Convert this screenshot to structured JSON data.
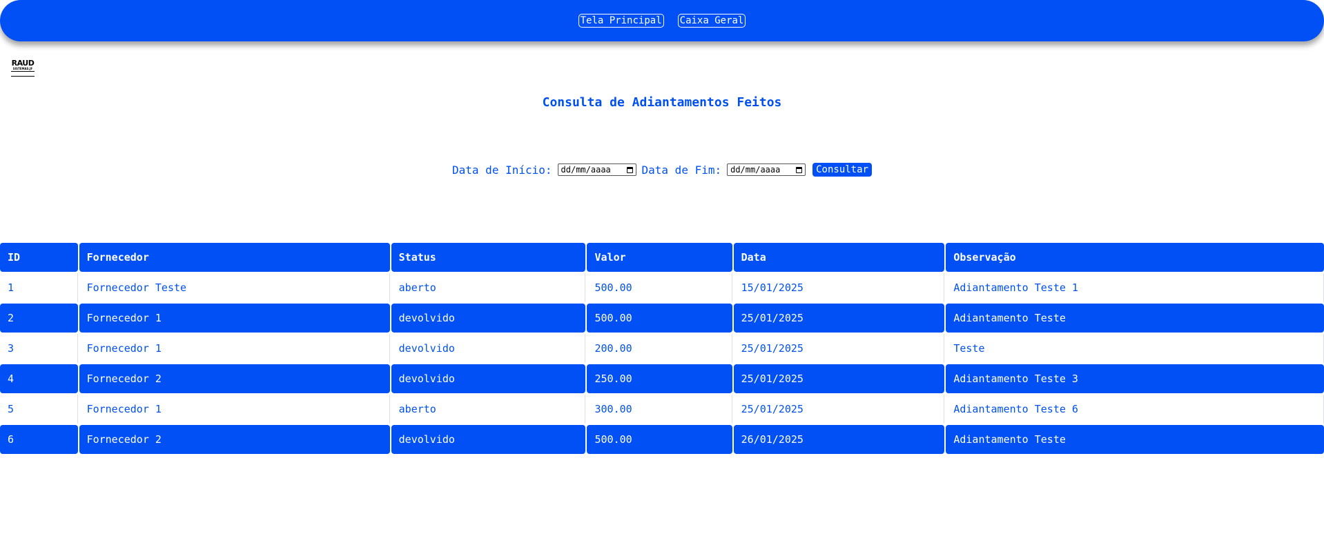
{
  "nav": {
    "buttons": [
      {
        "label": "Tela Principal"
      },
      {
        "label": "Caixa Geral"
      }
    ]
  },
  "logo": {
    "text": "RAUD",
    "subtext": "SISTEMAS.JF"
  },
  "page_title": "Consulta de Adiantamentos Feitos",
  "filters": {
    "start_label": "Data de Início:",
    "start_placeholder": "dd/mm/aaaa",
    "end_label": "Data de Fim:",
    "end_placeholder": "dd/mm/aaaa",
    "submit_label": "Consultar"
  },
  "table": {
    "headers": [
      "ID",
      "Fornecedor",
      "Status",
      "Valor",
      "Data",
      "Observação"
    ],
    "rows": [
      [
        "1",
        "Fornecedor Teste",
        "aberto",
        "500.00",
        "15/01/2025",
        "Adiantamento Teste 1"
      ],
      [
        "2",
        "Fornecedor 1",
        "devolvido",
        "500.00",
        "25/01/2025",
        "Adiantamento Teste"
      ],
      [
        "3",
        "Fornecedor 1",
        "devolvido",
        "200.00",
        "25/01/2025",
        "Teste"
      ],
      [
        "4",
        "Fornecedor 2",
        "devolvido",
        "250.00",
        "25/01/2025",
        "Adiantamento Teste 3"
      ],
      [
        "5",
        "Fornecedor 1",
        "aberto",
        "300.00",
        "25/01/2025",
        "Adiantamento Teste 6"
      ],
      [
        "6",
        "Fornecedor 2",
        "devolvido",
        "500.00",
        "26/01/2025",
        "Adiantamento Teste"
      ]
    ]
  },
  "colors": {
    "primary": "#0050f5",
    "text_accent": "#0050f0",
    "background": "#ffffff"
  },
  "icons": [
    "calendar-icon"
  ]
}
